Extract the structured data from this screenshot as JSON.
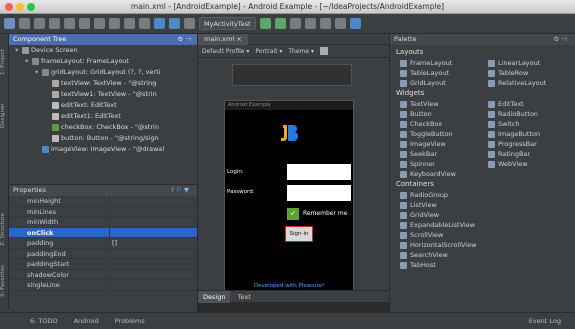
{
  "window": {
    "title": "main.xml - [AndroidExample] - Android Example - [~/IdeaProjects/AndroidExample]"
  },
  "toolbar": {
    "run_config": "MyActivityTest"
  },
  "left_tabs": [
    "1: Project",
    "Designer",
    "Z: Structure",
    "2: Favorites"
  ],
  "tree": {
    "title": "Component Tree",
    "rows": [
      {
        "indent": 0,
        "label": "Device Screen",
        "icon": "device-icon",
        "color": "#9a9a9a"
      },
      {
        "indent": 1,
        "label": "frameLayout: FrameLayout",
        "icon": "layout-icon",
        "color": "#888"
      },
      {
        "indent": 2,
        "label": "gridLayout: GridLayout (?, ?, verti",
        "icon": "grid-icon",
        "color": "#888"
      },
      {
        "indent": 3,
        "label": "textView: TextView - \"@string",
        "icon": "text-icon",
        "color": "#aaa"
      },
      {
        "indent": 3,
        "label": "textView1: TextView - \"@strin",
        "icon": "text-icon",
        "color": "#aaa"
      },
      {
        "indent": 3,
        "label": "editText: EditText",
        "icon": "edittext-icon",
        "color": "#bbb"
      },
      {
        "indent": 3,
        "label": "editText1: EditText",
        "icon": "edittext-icon",
        "color": "#bbb"
      },
      {
        "indent": 3,
        "label": "checkBox: CheckBox - \"@strin",
        "icon": "checkbox-icon",
        "color": "#5c9d3c"
      },
      {
        "indent": 3,
        "label": "button: Button - \"@string/sign",
        "icon": "button-icon",
        "color": "#bbb"
      },
      {
        "indent": 2,
        "label": "imageView: ImageView - \"@drawal",
        "icon": "image-icon",
        "color": "#4b88c7"
      }
    ]
  },
  "properties": {
    "title": "Properties",
    "rows": [
      {
        "name": "minHeight",
        "value": ""
      },
      {
        "name": "minLines",
        "value": ""
      },
      {
        "name": "minWidth",
        "value": ""
      },
      {
        "name": "onClick",
        "value": "",
        "selected": true
      },
      {
        "name": "padding",
        "value": "[]"
      },
      {
        "name": "paddingEnd",
        "value": ""
      },
      {
        "name": "paddingStart",
        "value": ""
      },
      {
        "name": "shadowColor",
        "value": ""
      },
      {
        "name": "singleLine",
        "value": ""
      }
    ]
  },
  "editor": {
    "tab": "main.xml",
    "toolbar": [
      "Default Profile ▾",
      "Portrait ▾",
      "Theme ▾"
    ],
    "device": {
      "app_title": "Android Example",
      "login_label": "Login:",
      "password_label": "Password:",
      "remember_label": "Remember me",
      "signin_label": "Sign-in",
      "footer": "Developed with Pleasure!"
    },
    "bottom_tabs": [
      "Design",
      "Text"
    ]
  },
  "palette": {
    "title": "Palette",
    "layouts_label": "Layouts",
    "layouts": [
      "FrameLayout",
      "LinearLayout",
      "TableLayout",
      "TableRow",
      "GridLayout",
      "RelativeLayout"
    ],
    "widgets_label": "Widgets",
    "widgets": [
      "TextView",
      "EditText",
      "Button",
      "RadioButton",
      "CheckBox",
      "Switch",
      "ToggleButton",
      "ImageButton",
      "ImageView",
      "ProgressBar",
      "SeekBar",
      "RatingBar",
      "Spinner",
      "WebView",
      "KeyboardView"
    ],
    "containers_label": "Containers",
    "containers": [
      "RadioGroup",
      "ListView",
      "GridView",
      "ExpandableListView",
      "ScrollView",
      "HorizontalScrollView",
      "SearchView",
      "TabHost"
    ]
  },
  "status": {
    "todo": "6: TODO",
    "android": "Android",
    "problems": "Problems",
    "event_log": "Event Log"
  }
}
